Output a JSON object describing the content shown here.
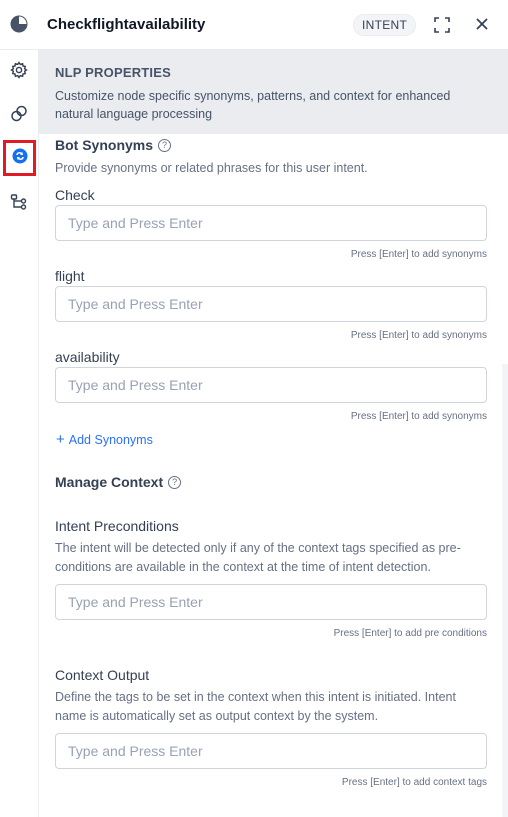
{
  "header": {
    "title": "Checkflightavailability",
    "badge": "INTENT",
    "icons": [
      "node-icon",
      "expand-icon",
      "close-icon"
    ]
  },
  "rail": {
    "items": [
      {
        "icon": "gear-icon"
      },
      {
        "icon": "connections-icon"
      },
      {
        "icon": "nlp-icon",
        "active": true
      },
      {
        "icon": "flow-icon"
      }
    ]
  },
  "banner": {
    "title": "NLP PROPERTIES",
    "description": "Customize node specific synonyms, patterns, and context for enhanced natural language processing"
  },
  "synonyms": {
    "title": "Bot Synonyms",
    "description": "Provide synonyms or related phrases for this user intent.",
    "fields": [
      {
        "label": "Check",
        "value": "",
        "placeholder": "Type and Press Enter",
        "hint": "Press [Enter] to add synonyms"
      },
      {
        "label": "flight",
        "value": "",
        "placeholder": "Type and Press Enter",
        "hint": "Press [Enter] to add synonyms"
      },
      {
        "label": "availability",
        "value": "",
        "placeholder": "Type and Press Enter",
        "hint": "Press [Enter] to add synonyms"
      }
    ],
    "add_label": "Add Synonyms"
  },
  "context": {
    "title": "Manage Context",
    "preconditions": {
      "label": "Intent Preconditions",
      "description": "The intent will be detected only if any of the context tags specified as pre-conditions are available in the context at the time of intent detection.",
      "placeholder": "Type and Press Enter",
      "hint": "Press [Enter] to add pre conditions"
    },
    "output": {
      "label": "Context Output",
      "description": "Define the tags to be set in the context when this intent is initiated. Intent name is automatically set as output context by the system.",
      "placeholder": "Type and Press Enter",
      "hint": "Press [Enter] to add context tags"
    }
  },
  "colors": {
    "accent": "#2970ff",
    "highlight": "#e01b24",
    "banner_bg": "#eaecf0"
  }
}
